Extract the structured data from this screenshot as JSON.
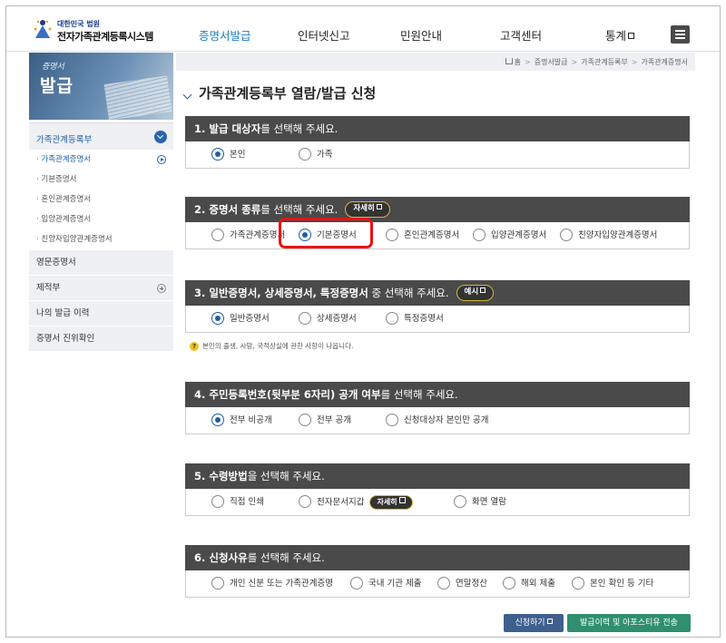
{
  "header": {
    "logo_small": "대한민국 법원",
    "logo_big": "전자가족관계등록시스템",
    "nav": [
      "증명서발급",
      "인터넷신고",
      "민원안내",
      "고객센터",
      "통계"
    ]
  },
  "banner": {
    "line1": "증명서",
    "line2": "발급"
  },
  "lnb": {
    "group_title": "가족관계등록부",
    "sub_items": [
      "· 가족관계증명서",
      "· 기본증명서",
      "· 혼인관계증명서",
      "· 입양관계증명서",
      "· 친양자입양관계증명서"
    ],
    "items": [
      "영문증명서",
      "제적부",
      "나의 발급 이력",
      "증명서 진위확인"
    ]
  },
  "breadcrumb": [
    "홈",
    "증명서발급",
    "가족관계등록부",
    "가족관계증명서"
  ],
  "page_title": "가족관계등록부 열람/발급 신청",
  "sections": {
    "s1": {
      "bold": "1. 발급 대상자",
      "rest": "를 선택해 주세요.",
      "options": [
        "본인",
        "가족"
      ]
    },
    "s2": {
      "bold": "2. 증명서 종류",
      "rest": "를 선택해 주세요.",
      "pill": "자세히",
      "options": [
        "가족관계증명서",
        "기본증명서",
        "혼인관계증명서",
        "입양관계증명서",
        "친양자입양관계증명서"
      ]
    },
    "s3": {
      "bold": "3. 일반증명서, 상세증명서, 특정증명서",
      "rest": " 중 선택해 주세요.",
      "pill": "예시",
      "options": [
        "일반증명서",
        "상세증명서",
        "특정증명서"
      ]
    },
    "s4": {
      "bold": "4. 주민등록번호(뒷부분 6자리) 공개 여부",
      "rest": "를 선택해 주세요.",
      "options": [
        "전부 비공개",
        "전부 공개",
        "신청대상자 본인만 공개"
      ]
    },
    "s5": {
      "bold": "5. 수령방법",
      "rest": "을 선택해 주세요.",
      "options": [
        "직접 인쇄",
        "전자문서지갑",
        "화면 열람"
      ],
      "pill": "자세히"
    },
    "s6": {
      "bold": "6. 신청사유",
      "rest": "를 선택해 주세요.",
      "options": [
        "개인 신분 또는 가족관계증명",
        "국내 기관 제출",
        "연말정산",
        "해외 제출",
        "본인 확인 등 기타"
      ]
    }
  },
  "note": "본인의 출생, 사망, 국적상실에 관한 사항이 나옵니다.",
  "note_icon": "?",
  "buttons": {
    "apply": "신청하기",
    "send": "발급이력 및 아포스티유 전송"
  },
  "colors": {
    "accent": "#1f5fa8",
    "section_header": "#4a4a4a",
    "highlight": "#ee1111",
    "apply_button": "#3f5f8f",
    "send_button": "#2f8f6f"
  }
}
